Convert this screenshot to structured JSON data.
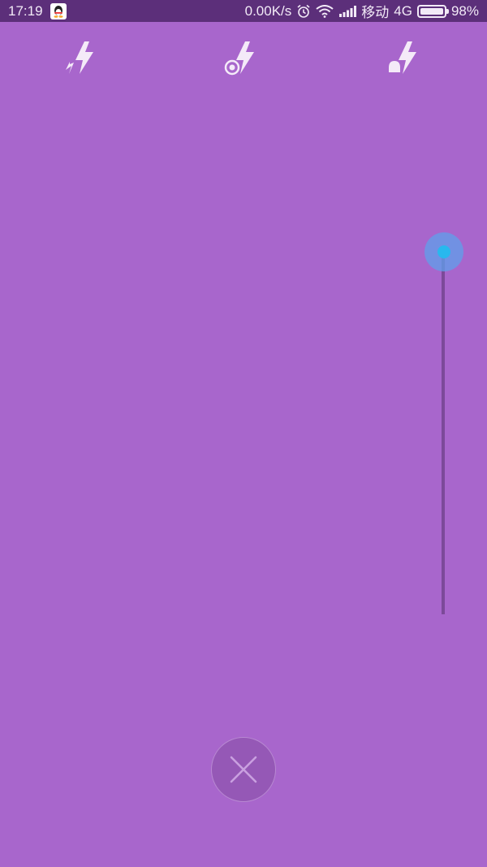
{
  "status_bar": {
    "time": "17:19",
    "network_speed": "0.00K/s",
    "carrier": "移动",
    "network_type": "4G",
    "battery": "98%",
    "icons": [
      "qq-icon",
      "alarm-icon",
      "wifi-icon",
      "signal-icon",
      "battery-icon"
    ]
  },
  "flash_modes": [
    {
      "id": "auto",
      "icon": "flash-auto-icon"
    },
    {
      "id": "on",
      "icon": "flash-on-icon"
    },
    {
      "id": "torch",
      "icon": "flash-torch-icon"
    }
  ],
  "zoom_slider": {
    "value": 1.0
  },
  "close_button": {
    "icon": "close-icon"
  },
  "colors": {
    "background": "#a866cc",
    "status_bar": "#5c2f7a",
    "slider_knob": "#28b8ee",
    "icon": "#f4eaf8"
  }
}
